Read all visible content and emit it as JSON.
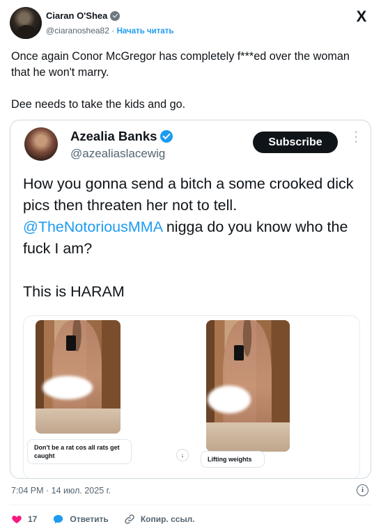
{
  "author": {
    "name": "Ciaran O'Shea",
    "handle": "@ciaranoshea82",
    "separator": "·",
    "follow_label": "Начать читать"
  },
  "platform_logo": "X",
  "tweet": {
    "text": "Once again Conor McGregor has completely f***ed over the woman that  he won't marry.\n\nDee needs to take the kids and go."
  },
  "quote": {
    "name": "Azealia Banks",
    "handle": "@azealiaslacewig",
    "subscribe_label": "Subscribe",
    "text_before": "How you gonna send a bitch a some crooked dick pics then threaten her not to tell. ",
    "mention": "@TheNotoriousMMA",
    "text_after": " nigga do you know who the fuck I am?\n\nThis is HARAM",
    "media": {
      "captions": [
        "Don't be a rat cos all rats get caught",
        "Lifting weights"
      ]
    }
  },
  "timestamp": "7:04 PM · 14 июл. 2025 г.",
  "actions": {
    "like_count": "17",
    "reply_label": "Ответить",
    "copy_link_label": "Копир. ссыл."
  },
  "colors": {
    "accent": "#1d9bf0",
    "like": "#f91880",
    "text_secondary": "#536471"
  },
  "icons": [
    "verified-gray-icon",
    "x-logo-icon",
    "verified-blue-icon",
    "more-icon",
    "download-icon",
    "info-icon",
    "heart-icon",
    "reply-icon",
    "link-icon"
  ]
}
